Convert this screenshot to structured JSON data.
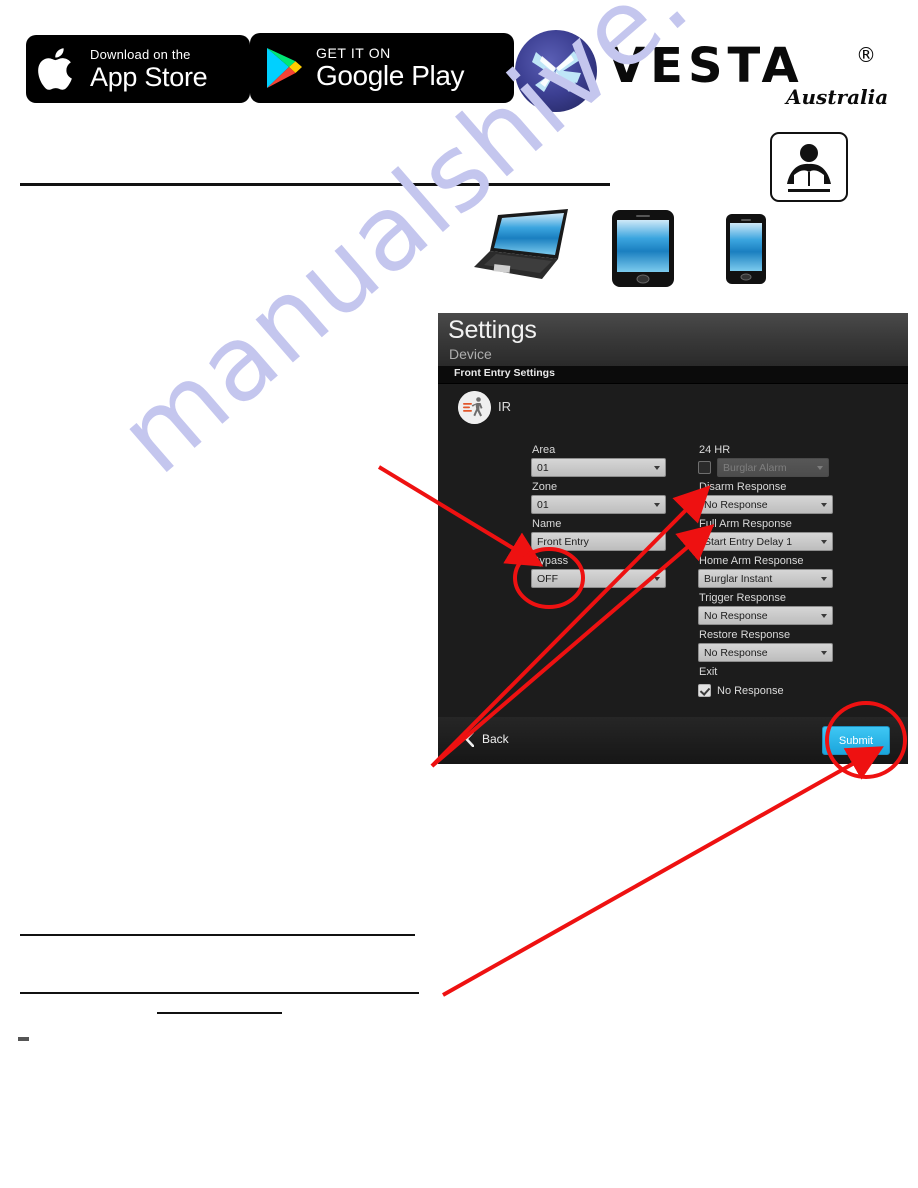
{
  "badges": {
    "app_store": {
      "small": "Download on the",
      "large": "App Store",
      "icon": "apple-icon"
    },
    "google_play": {
      "small": "GET IT ON",
      "large": "Google Play",
      "icon": "google-play-triangle-icon"
    }
  },
  "brand": {
    "name": "VESTA",
    "registered": "®",
    "region": "Australia",
    "logo_icon": "vesta-pinwheel-logo"
  },
  "read_manual_icon": "read-instructions-icon",
  "devices": [
    {
      "name": "laptop-image"
    },
    {
      "name": "tablet-image"
    },
    {
      "name": "phone-image"
    }
  ],
  "watermark": {
    "text": "manualshive.com",
    "color": "#c4c6ee"
  },
  "app": {
    "title": "Settings",
    "subtitle": "Device",
    "section": "Front Entry Settings",
    "device_type": "IR",
    "device_icon": "motion-sensor-walking-icon",
    "left_fields": [
      {
        "label": "Area",
        "value": "01",
        "type": "select"
      },
      {
        "label": "Zone",
        "value": "01",
        "type": "select"
      },
      {
        "label": "Name",
        "value": "Front Entry",
        "type": "text"
      },
      {
        "label": "Bypass",
        "value": "OFF",
        "type": "select"
      }
    ],
    "right_fields": [
      {
        "label": "24 HR",
        "value": "Burglar Alarm",
        "type": "checkbox-select",
        "checked": false,
        "disabled": true
      },
      {
        "label": "Disarm Response",
        "value": "No Response",
        "type": "select"
      },
      {
        "label": "Full Arm Response",
        "value": "Start Entry Delay 1",
        "type": "select"
      },
      {
        "label": "Home Arm Response",
        "value": "Burglar Instant",
        "type": "select"
      },
      {
        "label": "Trigger Response",
        "value": "No Response",
        "type": "select"
      },
      {
        "label": "Restore Response",
        "value": "No Response",
        "type": "select"
      },
      {
        "label": "Exit",
        "value": "No Response",
        "type": "checkbox",
        "checked": true
      }
    ],
    "back_label": "Back",
    "submit_label": "Submit",
    "accent_color": "#29b6e8"
  },
  "annotation_color": "#ee1111"
}
